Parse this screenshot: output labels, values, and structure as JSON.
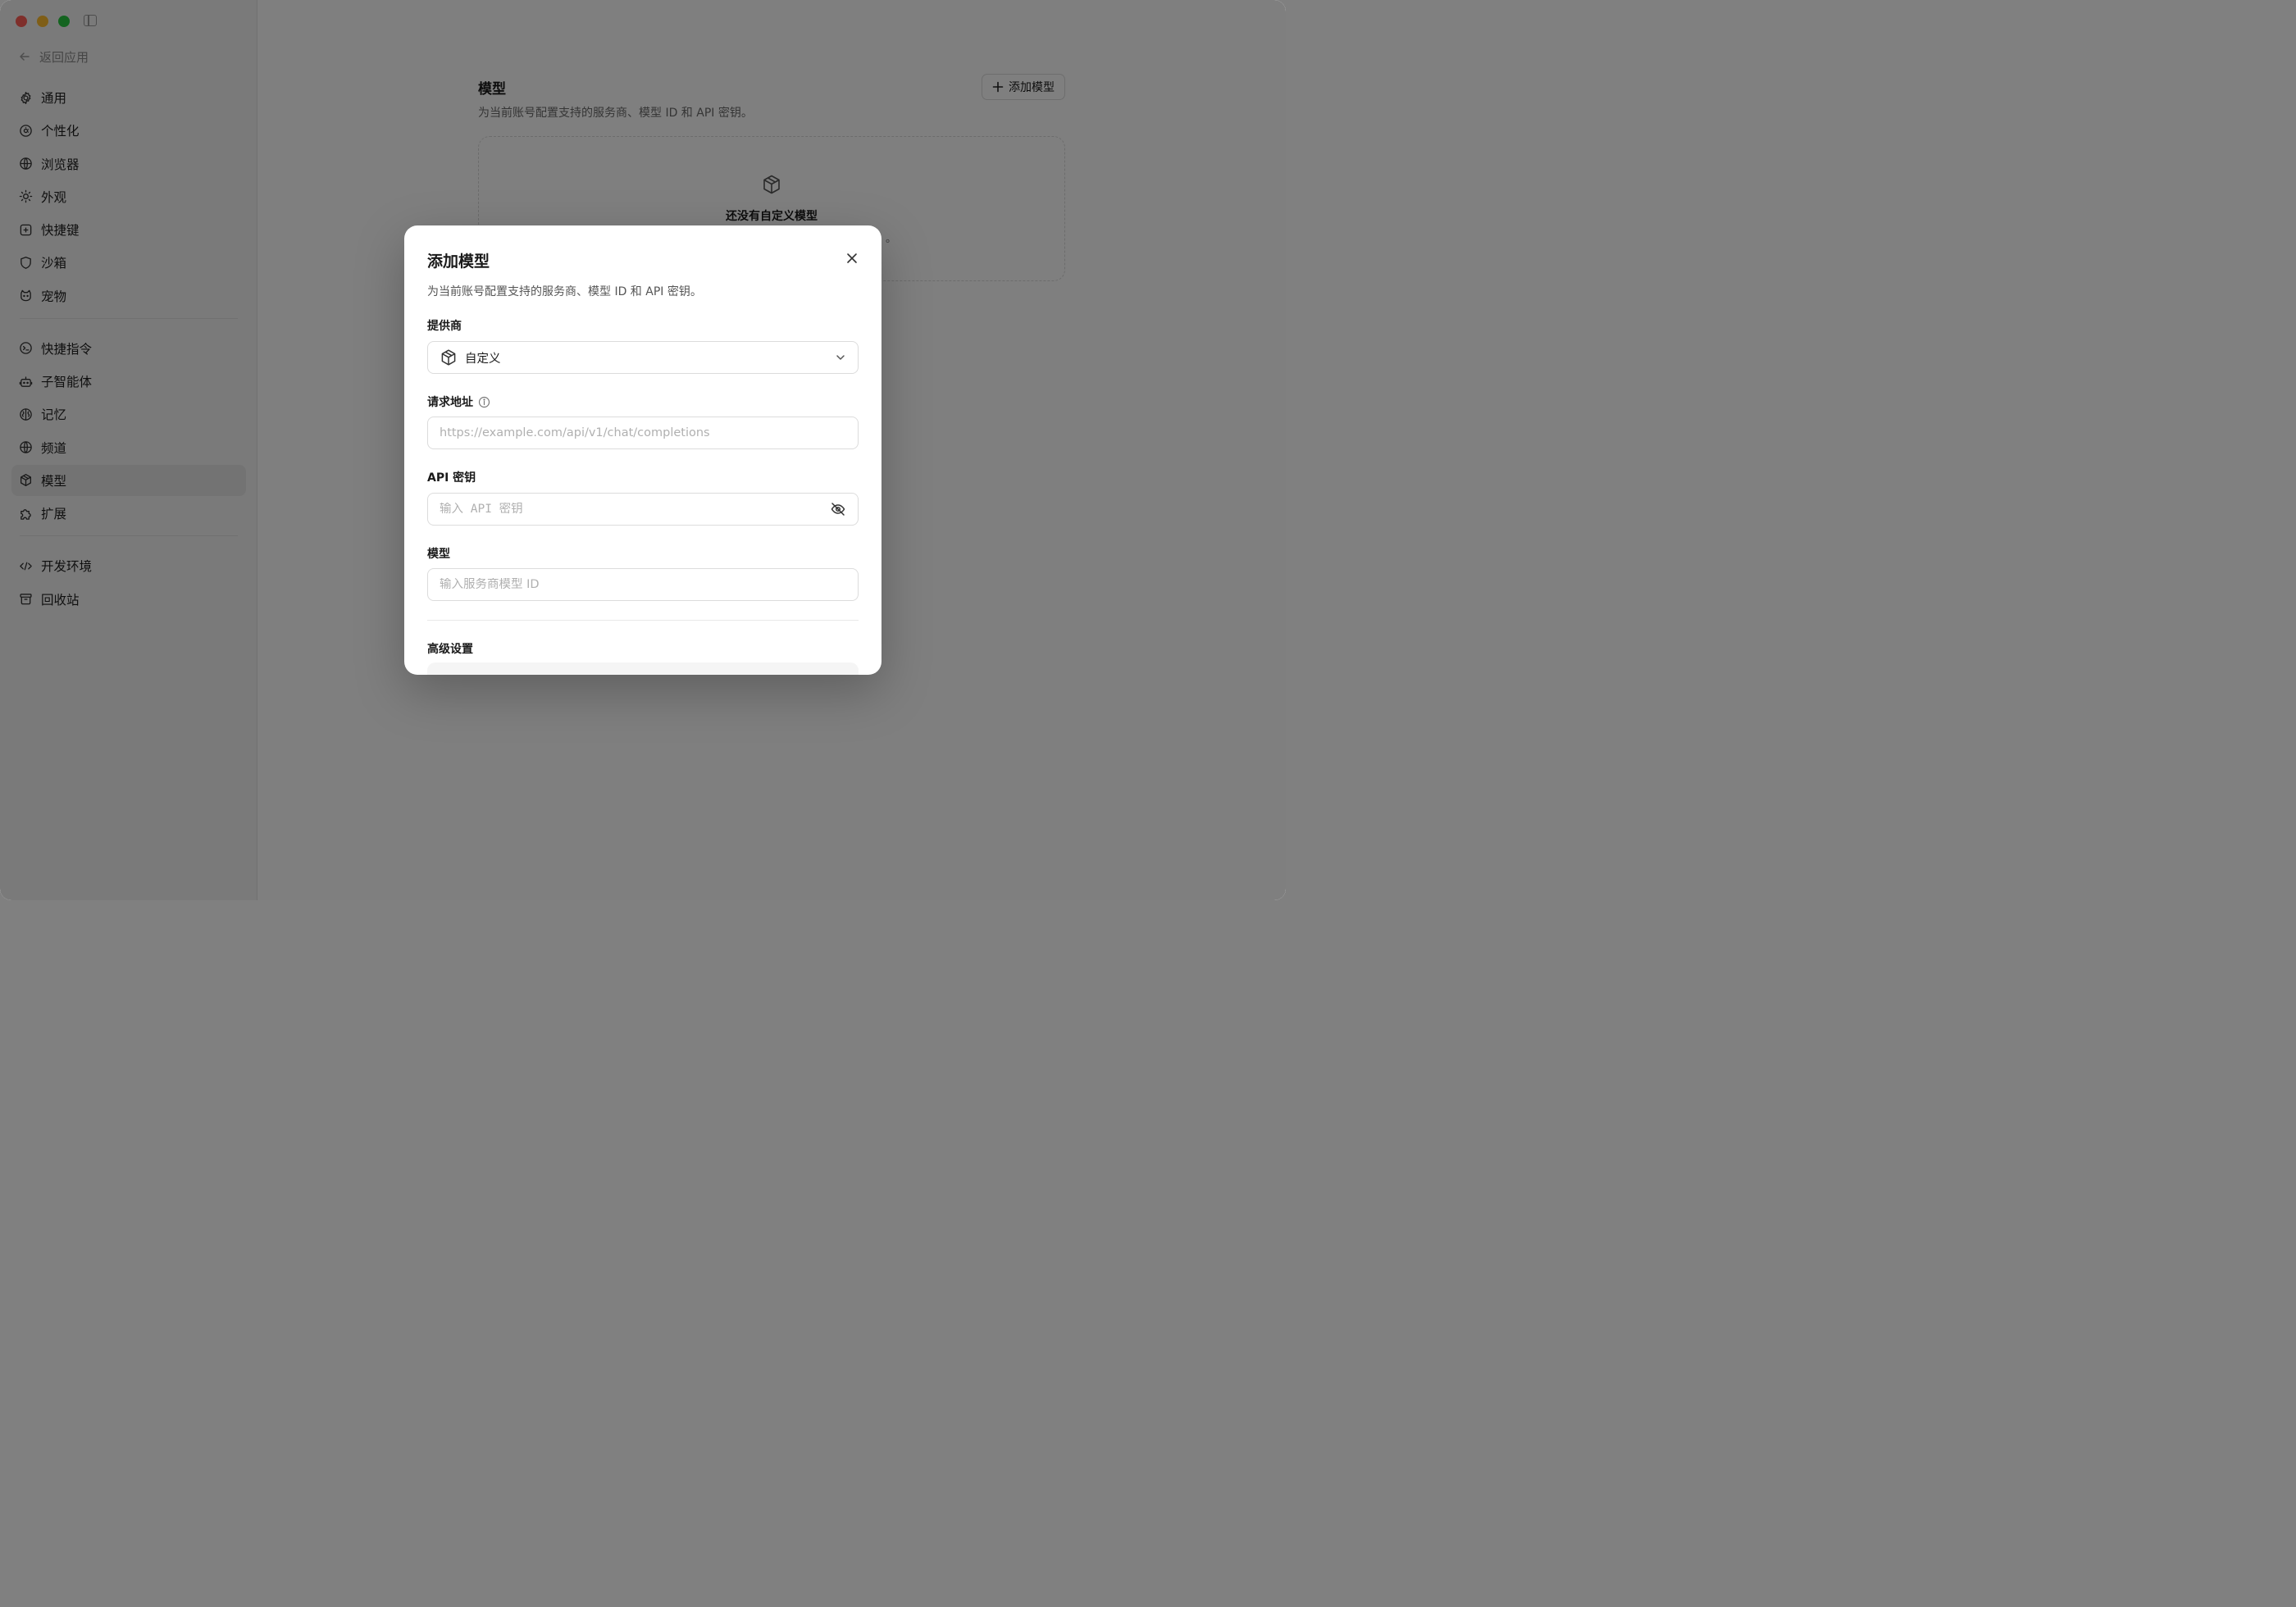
{
  "sidebar": {
    "back_label": "返回应用",
    "group1": [
      {
        "label": "通用",
        "icon": "gear-icon"
      },
      {
        "label": "个性化",
        "icon": "palette-icon"
      },
      {
        "label": "浏览器",
        "icon": "browser-icon"
      },
      {
        "label": "外观",
        "icon": "sun-icon"
      },
      {
        "label": "快捷键",
        "icon": "keyboard-icon"
      },
      {
        "label": "沙箱",
        "icon": "shield-icon"
      },
      {
        "label": "宠物",
        "icon": "pet-icon"
      }
    ],
    "group2": [
      {
        "label": "快捷指令",
        "icon": "command-icon"
      },
      {
        "label": "子智能体",
        "icon": "robot-icon"
      },
      {
        "label": "记忆",
        "icon": "brain-icon"
      },
      {
        "label": "频道",
        "icon": "globe-icon"
      },
      {
        "label": "模型",
        "icon": "cube-icon",
        "active": true
      },
      {
        "label": "扩展",
        "icon": "puzzle-icon"
      }
    ],
    "group3": [
      {
        "label": "开发环境",
        "icon": "code-icon"
      },
      {
        "label": "回收站",
        "icon": "archive-icon"
      }
    ]
  },
  "main": {
    "title": "模型",
    "description": "为当前账号配置支持的服务商、模型 ID 和 API 密钥。",
    "add_button": "添加模型",
    "empty_title": "还没有自定义模型",
    "empty_desc_visible_tail": "。"
  },
  "modal": {
    "title": "添加模型",
    "description": "为当前账号配置支持的服务商、模型 ID 和 API 密钥。",
    "provider": {
      "label": "提供商",
      "value": "自定义"
    },
    "endpoint": {
      "label": "请求地址",
      "placeholder": "https://example.com/api/v1/chat/completions"
    },
    "api_key": {
      "label": "API 密钥",
      "placeholder": "输入 API 密钥"
    },
    "model": {
      "label": "模型",
      "placeholder": "输入服务商模型 ID"
    },
    "advanced_label": "高级设置"
  },
  "colors": {
    "traffic_red": "#fe5f57",
    "traffic_yellow": "#febc2e",
    "traffic_green": "#28c840",
    "overlay": "rgba(0,0,0,0.5)"
  }
}
